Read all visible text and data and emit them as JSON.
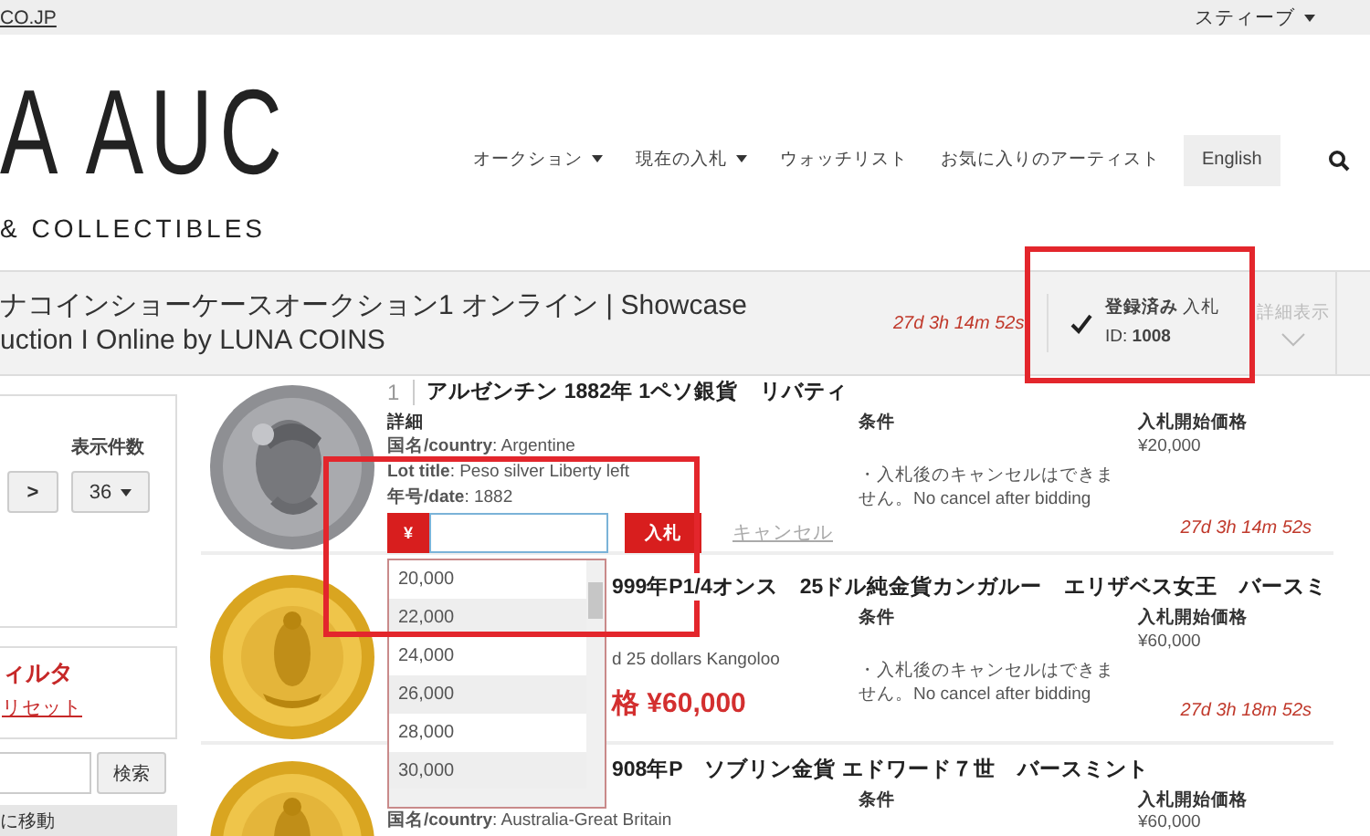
{
  "top_bar": {
    "site_link": "CO.JP",
    "user_menu": "スティーブ"
  },
  "logo": {
    "name": "A AUC",
    "tagline": "& COLLECTIBLES"
  },
  "nav": [
    {
      "label": "オークション",
      "dropdown": true
    },
    {
      "label": "現在の入札",
      "dropdown": true
    },
    {
      "label": "ウォッチリスト",
      "dropdown": false
    },
    {
      "label": "お気に入りのアーティスト",
      "dropdown": false
    }
  ],
  "language_button": "English",
  "auction": {
    "title_line_1": "ナコインショーケースオークション1 オンライン | Showcase",
    "title_line_2": "uction I Online by LUNA COINS",
    "countdown": "27d 3h 14m 52s",
    "registration": {
      "registered": true,
      "status": "**登録済み** 入札",
      "id": "ID: **1008**"
    },
    "details_toggle": {
      "label": "詳細表示",
      "disabled": true
    }
  },
  "sidebar": {
    "per_page_label": "表示件数",
    "next_button": ">",
    "per_page": "36",
    "filter_title": "ィルタ",
    "reset_link": "リセット",
    "search_button": "検索",
    "jump_header": "に移動"
  },
  "lots": [
    {
      "number": "1",
      "title": "アルゼンチン 1882年 1ペソ銀貨　リバティ",
      "details_label": "詳細",
      "fields": [
        "**国名/country**: Argentine",
        "**Lot title**: Peso silver Liberty left",
        "**年号/date**: 1882"
      ],
      "conditions_label": "条件",
      "conditions": "・入札後のキャンセルはできません。No cancel after bidding",
      "price_label": "入札開始価格",
      "price": "¥20,000",
      "countdown": "27d 3h 14m 52s"
    },
    {
      "title": "999年P1/4オンス　25ドル純金貨カンガルー　エリザベス女王　バースミ",
      "fields": [
        "d 25 dollars Kangoloo"
      ],
      "current_price": "格 ¥60,000",
      "conditions_label": "条件",
      "conditions": "・入札後のキャンセルはできません。No cancel after bidding",
      "price_label": "入札開始価格",
      "price": "¥60,000",
      "countdown": "27d 3h 18m 52s"
    },
    {
      "title": "908年P　ソブリン金貨 エドワード７世　バースミント",
      "fields": [
        "**国名/country**: Australia-Great Britain"
      ],
      "conditions_label": "条件",
      "price_label": "入札開始価格",
      "price": "¥60,000"
    }
  ],
  "bid_entry": {
    "currency": "¥",
    "bid_button": "入札",
    "cancel_link": "キャンセル",
    "options": [
      "20,000",
      "22,000",
      "24,000",
      "26,000",
      "28,000",
      "30,000"
    ]
  },
  "annotations": [
    {
      "kind": "frame"
    },
    {
      "kind": "frame"
    }
  ]
}
